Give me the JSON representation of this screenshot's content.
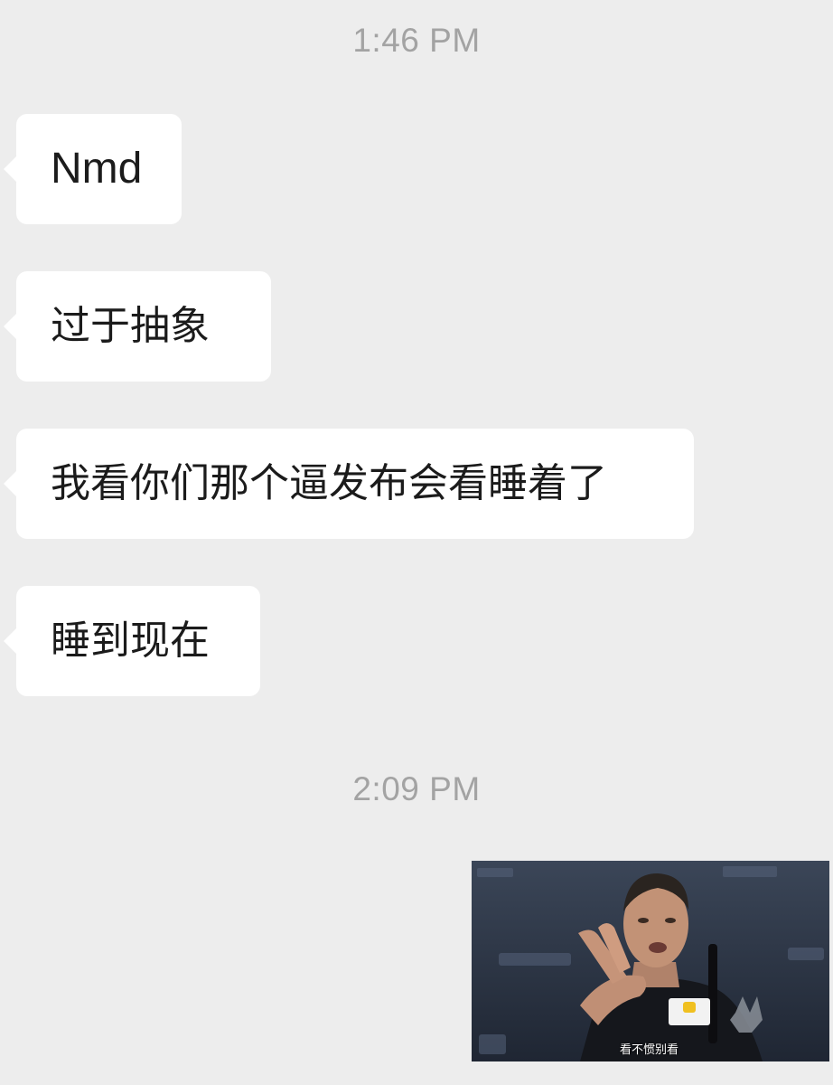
{
  "chat": {
    "timestamps": [
      "1:46 PM",
      "2:09 PM"
    ],
    "messages": [
      {
        "sender": "other",
        "text": "Nmd"
      },
      {
        "sender": "other",
        "text": "过于抽象"
      },
      {
        "sender": "other",
        "text": "我看你们那个逼发布会看睡着了"
      },
      {
        "sender": "other",
        "text": "睡到现在"
      }
    ],
    "sticker": {
      "caption": "看不惯别看",
      "icon": "gif-sticker-man-pointing"
    }
  },
  "colors": {
    "background": "#ededed",
    "bubble": "#ffffff",
    "timestamp": "#a3a3a3",
    "text": "#1b1b1b"
  }
}
